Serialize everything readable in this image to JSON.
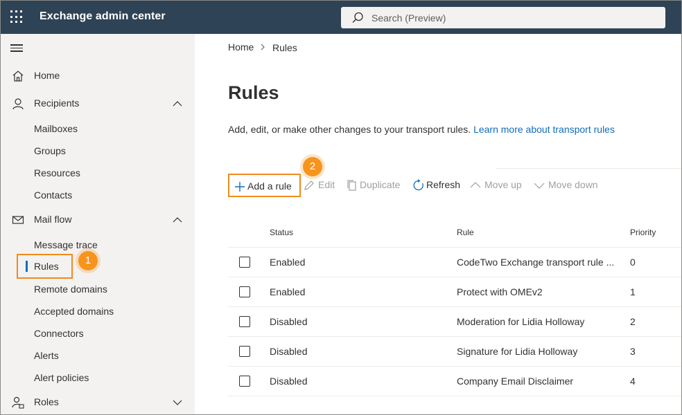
{
  "app": {
    "title": "Exchange admin center"
  },
  "search": {
    "placeholder": "Search (Preview)"
  },
  "sidebar": {
    "home": "Home",
    "recipients": {
      "label": "Recipients",
      "items": [
        "Mailboxes",
        "Groups",
        "Resources",
        "Contacts"
      ]
    },
    "mailflow": {
      "label": "Mail flow",
      "items": [
        "Message trace",
        "Rules",
        "Remote domains",
        "Accepted domains",
        "Connectors",
        "Alerts",
        "Alert policies"
      ]
    },
    "roles": "Roles"
  },
  "callouts": [
    "1",
    "2"
  ],
  "breadcrumb": {
    "home": "Home",
    "current": "Rules"
  },
  "page": {
    "title": "Rules",
    "description": "Add, edit, or make other changes to your transport rules.",
    "link": "Learn more about transport rules"
  },
  "toolbar": {
    "add": "Add a rule",
    "edit": "Edit",
    "duplicate": "Duplicate",
    "refresh": "Refresh",
    "move_up": "Move up",
    "move_down": "Move down"
  },
  "table": {
    "headers": {
      "status": "Status",
      "rule": "Rule",
      "priority": "Priority"
    },
    "rows": [
      {
        "status": "Enabled",
        "rule": "CodeTwo Exchange transport rule ...",
        "priority": "0"
      },
      {
        "status": "Enabled",
        "rule": "Protect with OMEv2",
        "priority": "1"
      },
      {
        "status": "Disabled",
        "rule": "Moderation for Lidia Holloway",
        "priority": "2"
      },
      {
        "status": "Disabled",
        "rule": "Signature for Lidia Holloway",
        "priority": "3"
      },
      {
        "status": "Disabled",
        "rule": "Company Email Disclaimer",
        "priority": "4"
      }
    ]
  },
  "colors": {
    "topbar": "#2f4356",
    "accent": "#0f6cbd",
    "highlight": "#f08a1c",
    "sidebar": "#f3f2f1"
  }
}
